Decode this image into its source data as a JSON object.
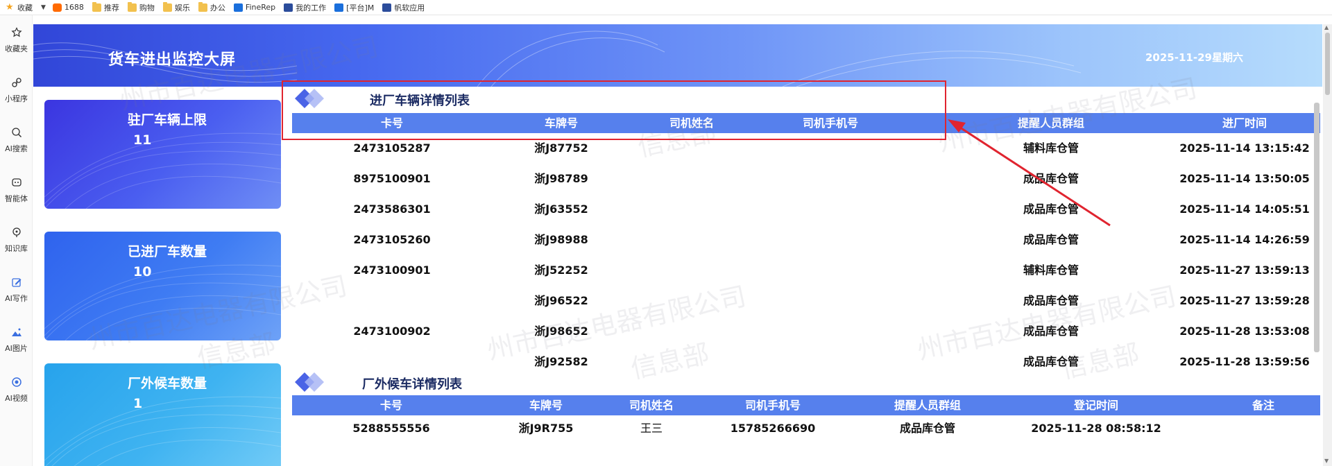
{
  "bookmarks": [
    {
      "label": "收藏",
      "icon": "star-icon"
    },
    {
      "label": "1688",
      "icon": "1688-icon"
    },
    {
      "label": "推荐",
      "icon": "folder-icon"
    },
    {
      "label": "购物",
      "icon": "folder-icon"
    },
    {
      "label": "娱乐",
      "icon": "folder-icon"
    },
    {
      "label": "办公",
      "icon": "folder-icon"
    },
    {
      "label": "FineRep",
      "icon": "finereport-icon"
    },
    {
      "label": "我的工作",
      "icon": "app-icon"
    },
    {
      "label": "[平台]M",
      "icon": "app-icon"
    },
    {
      "label": "帆软应用",
      "icon": "app-icon"
    }
  ],
  "sidebar": [
    {
      "label": "收藏夹",
      "icon": "star-outline-icon"
    },
    {
      "label": "小程序",
      "icon": "mini-program-icon"
    },
    {
      "label": "AI搜索",
      "icon": "search-icon"
    },
    {
      "label": "智能体",
      "icon": "agent-icon"
    },
    {
      "label": "知识库",
      "icon": "knowledge-icon"
    },
    {
      "label": "AI写作",
      "icon": "write-icon"
    },
    {
      "label": "AI图片",
      "icon": "image-icon"
    },
    {
      "label": "AI视频",
      "icon": "video-icon"
    }
  ],
  "dashboard": {
    "title": "货车进出监控大屏",
    "date": "2025-11-29星期六"
  },
  "cards": [
    {
      "label": "驻厂车辆上限",
      "value": "11"
    },
    {
      "label": "已进厂车数量",
      "value": "10"
    },
    {
      "label": "厂外候车数量",
      "value": "1"
    }
  ],
  "entry_table": {
    "title": "进厂车辆详情列表",
    "columns": [
      "卡号",
      "车牌号",
      "司机姓名",
      "司机手机号",
      "提醒人员群组",
      "进厂时间"
    ],
    "rows": [
      [
        "2473105287",
        "浙J87752",
        "",
        "",
        "辅料库仓管",
        "2025-11-14 13:15:42"
      ],
      [
        "8975100901",
        "浙J98789",
        "",
        "",
        "成品库仓管",
        "2025-11-14 13:50:05"
      ],
      [
        "2473586301",
        "浙J63552",
        "",
        "",
        "成品库仓管",
        "2025-11-14 14:05:51"
      ],
      [
        "2473105260",
        "浙J98988",
        "",
        "",
        "成品库仓管",
        "2025-11-14 14:26:59"
      ],
      [
        "2473100901",
        "浙J52252",
        "",
        "",
        "辅料库仓管",
        "2025-11-27 13:59:13"
      ],
      [
        "",
        "浙J96522",
        "",
        "",
        "成品库仓管",
        "2025-11-27 13:59:28"
      ],
      [
        "2473100902",
        "浙J98652",
        "",
        "",
        "成品库仓管",
        "2025-11-28 13:53:08"
      ],
      [
        "",
        "浙J92582",
        "",
        "",
        "成品库仓管",
        "2025-11-28 13:59:56"
      ]
    ]
  },
  "waiting_table": {
    "title": "厂外候车详情列表",
    "columns": [
      "卡号",
      "车牌号",
      "司机姓名",
      "司机手机号",
      "提醒人员群组",
      "登记时间",
      "备注"
    ],
    "rows": [
      [
        "5288555556",
        "浙J9R755",
        "王三",
        "15785266690",
        "成品库仓管",
        "2025-11-28 08:58:12",
        ""
      ]
    ]
  },
  "watermark": {
    "company": "衢州市百达电器有限公司",
    "company_partial": "州市百达电器有限公司",
    "dept": "信息部"
  },
  "colors": {
    "header_start": "#3146d8",
    "header_end": "#b6dcfc",
    "table_header": "#5680ed",
    "annotation": "#e0242f"
  }
}
